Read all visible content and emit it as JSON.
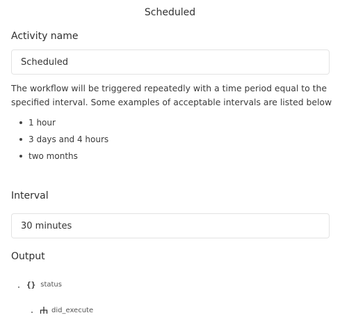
{
  "panel": {
    "title": "Scheduled"
  },
  "activity_name": {
    "label": "Activity name",
    "value": "Scheduled"
  },
  "description": "The workflow will be triggered repeatedly with a time period equal to the specified interval. Some examples of acceptable intervals are listed below",
  "examples": [
    "1 hour",
    "3 days and 4 hours",
    "two months"
  ],
  "interval": {
    "label": "Interval",
    "value": "30 minutes"
  },
  "output": {
    "label": "Output",
    "tree": [
      {
        "icon": "braces-icon",
        "name": "status"
      },
      {
        "icon": "branch-icon",
        "name": "did_execute"
      }
    ]
  }
}
